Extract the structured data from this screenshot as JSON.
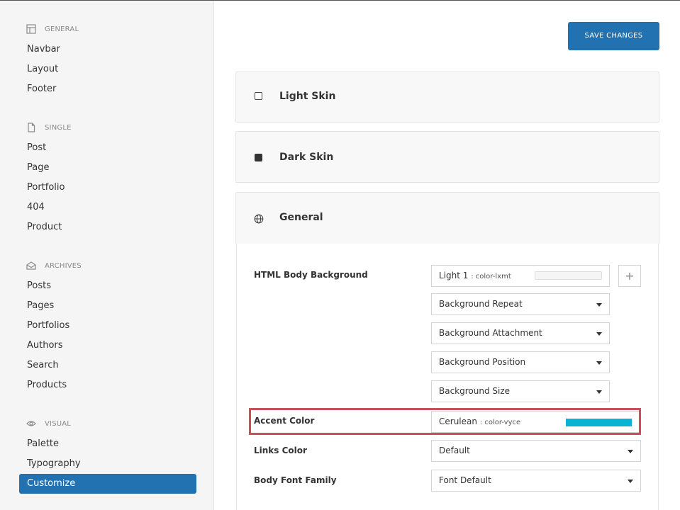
{
  "sidebar": {
    "sections": [
      {
        "heading": "GENERAL",
        "icon": "layout-icon",
        "items": [
          "Navbar",
          "Layout",
          "Footer"
        ]
      },
      {
        "heading": "SINGLE",
        "icon": "file-icon",
        "items": [
          "Post",
          "Page",
          "Portfolio",
          "404",
          "Product"
        ]
      },
      {
        "heading": "ARCHIVES",
        "icon": "envelope-open-icon",
        "items": [
          "Posts",
          "Pages",
          "Portfolios",
          "Authors",
          "Search",
          "Products"
        ]
      },
      {
        "heading": "VISUAL",
        "icon": "eye-icon",
        "items": [
          "Palette",
          "Typography",
          "Customize"
        ]
      }
    ],
    "active_item": "Customize"
  },
  "toolbar": {
    "save_label": "SAVE CHANGES"
  },
  "panels": {
    "light_skin": "Light Skin",
    "dark_skin": "Dark Skin",
    "general": "General"
  },
  "settings": {
    "html_body_background": {
      "label": "HTML Body Background",
      "color_name": "Light 1",
      "color_id": ": color-lxmt",
      "selects": [
        "Background Repeat",
        "Background Attachment",
        "Background Position",
        "Background Size"
      ],
      "add_symbol": "+"
    },
    "accent_color": {
      "label": "Accent Color",
      "color_name": "Cerulean",
      "color_id": ": color-vyce",
      "swatch": "#0ab3d1"
    },
    "links_color": {
      "label": "Links Color",
      "value": "Default"
    },
    "body_font_family": {
      "label": "Body Font Family",
      "value": "Font Default"
    }
  },
  "colors": {
    "accent": "#2271b1",
    "highlight": "#c9505a"
  }
}
